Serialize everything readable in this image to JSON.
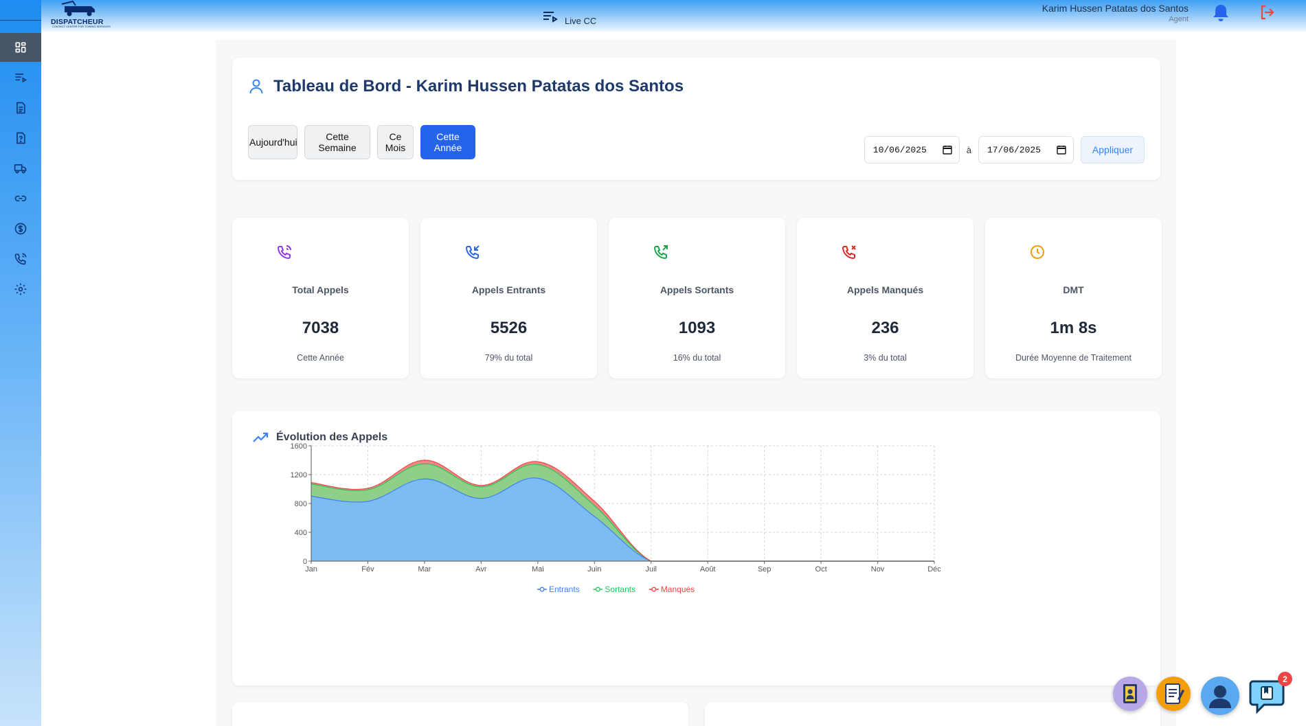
{
  "header": {
    "logo_text": "DISPATCHEUR",
    "logo_tagline": "CONTACT CENTER FOR TOWING SERVICES",
    "live_label": "Live CC",
    "user_name": "Karim Hussen Patatas dos Santos",
    "user_role": "Agent"
  },
  "sidebar": {
    "items": [
      {
        "icon": "dashboard-icon"
      },
      {
        "icon": "playlist-icon"
      },
      {
        "icon": "document-icon"
      },
      {
        "icon": "help-document-icon"
      },
      {
        "icon": "truck-icon"
      },
      {
        "icon": "link-icon"
      },
      {
        "icon": "dollar-icon"
      },
      {
        "icon": "phone-icon"
      },
      {
        "icon": "settings-icon"
      }
    ]
  },
  "dashboard": {
    "title": "Tableau de Bord - Karim Hussen Patatas dos Santos",
    "periods": [
      "Aujourd'hui",
      "Cette Semaine",
      "Ce Mois",
      "Cette Année"
    ],
    "active_period": "Cette Année",
    "date_from": "10/06/2025",
    "date_to": "17/06/2025",
    "date_separator": "à",
    "apply_label": "Appliquer"
  },
  "stats": [
    {
      "label": "Total Appels",
      "value": "7038",
      "sub": "Cette Année",
      "icon": "phone-call-icon",
      "color": "#9333ea"
    },
    {
      "label": "Appels Entrants",
      "value": "5526",
      "sub": "79% du total",
      "icon": "phone-incoming-icon",
      "color": "#2563eb"
    },
    {
      "label": "Appels Sortants",
      "value": "1093",
      "sub": "16% du total",
      "icon": "phone-outgoing-icon",
      "color": "#16a34a"
    },
    {
      "label": "Appels Manqués",
      "value": "236",
      "sub": "3% du total",
      "icon": "phone-missed-icon",
      "color": "#dc2626"
    },
    {
      "label": "DMT",
      "value": "1m 8s",
      "sub": "Durée Moyenne de Traitement",
      "icon": "clock-icon",
      "color": "#f59e0b"
    }
  ],
  "chart_section": {
    "title": "Évolution des Appels"
  },
  "chart_data": {
    "type": "area",
    "stacked": true,
    "categories": [
      "Jan",
      "Fév",
      "Mar",
      "Avr",
      "Mai",
      "Juin",
      "Juil",
      "Août",
      "Sep",
      "Oct",
      "Nov",
      "Déc"
    ],
    "series": [
      {
        "name": "Entrants",
        "color": "#3b82f6",
        "values": [
          900,
          830,
          1140,
          870,
          1150,
          620,
          0,
          0,
          0,
          0,
          0,
          0
        ]
      },
      {
        "name": "Sortants",
        "color": "#22c55e",
        "values": [
          170,
          160,
          210,
          160,
          190,
          150,
          0,
          0,
          0,
          0,
          0,
          0
        ]
      },
      {
        "name": "Manqués",
        "color": "#ef4444",
        "values": [
          20,
          20,
          50,
          20,
          40,
          60,
          0,
          0,
          0,
          0,
          0,
          0
        ]
      }
    ],
    "yticks": [
      0,
      400,
      800,
      1200,
      1600
    ],
    "ylim": [
      0,
      1600
    ],
    "grid": true,
    "legend": "bottom-center"
  },
  "floating": {
    "chat_badge": "2"
  }
}
